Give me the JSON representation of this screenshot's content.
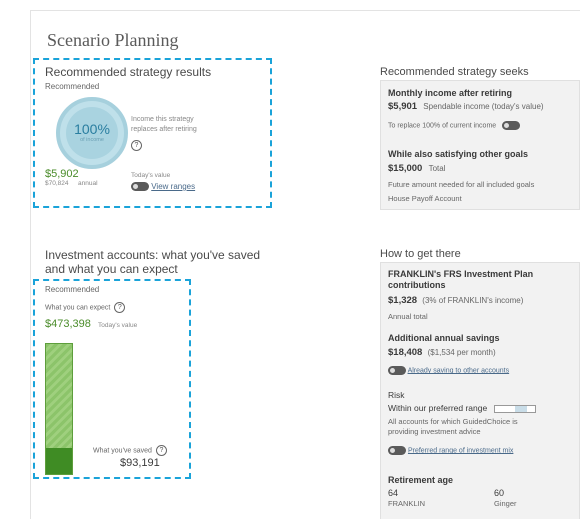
{
  "page": {
    "title": "Scenario Planning"
  },
  "strategy_results": {
    "heading": "Recommended strategy results",
    "badge": "Recommended",
    "percent": "100%",
    "percent_label": "of income",
    "replaces_text_1": "Income this strategy",
    "replaces_text_2": "replaces after retiring",
    "monthly": "$5,902",
    "annual_value": "$70,824",
    "annual_label": "annual",
    "todays_value": "Today's value",
    "view_ranges": "View ranges"
  },
  "seeks": {
    "heading": "Recommended strategy seeks",
    "monthly_title": "Monthly income after retiring",
    "monthly_value": "$5,901",
    "monthly_desc": "Spendable income (today's value)",
    "replace_text": "To replace 100% of current income",
    "other_title": "While also satisfying other goals",
    "other_value": "$15,000",
    "other_label": "Total",
    "future_text": "Future amount needed for all included goals",
    "goal_name": "House Payoff Account"
  },
  "investments": {
    "heading_1": "Investment accounts: what you've saved",
    "heading_2": "and what you can expect",
    "badge": "Recommended",
    "expect_label": "What you can expect",
    "expect_value": "$473,398",
    "expect_sub": "Today's value",
    "saved_label": "What you've saved",
    "saved_value": "$93,191",
    "saved_fraction": 0.197
  },
  "how": {
    "heading": "How to get there",
    "contrib_title_1": "FRANKLIN's FRS Investment Plan",
    "contrib_title_2": "contributions",
    "contrib_value": "$1,328",
    "contrib_desc": "(3% of FRANKLIN's income)",
    "annual_total": "Annual total",
    "savings_title": "Additional annual savings",
    "savings_value": "$18,408",
    "savings_desc": "($1,534 per month)",
    "already_saving": "Already saving to other accounts",
    "risk_title": "Risk",
    "risk_value": "Within our preferred range",
    "risk_desc_1": "All accounts for which GuidedChoice is",
    "risk_desc_2": "providing investment advice",
    "preferred_range": "Preferred range of investment mix",
    "retire_title": "Retirement age",
    "age_1": "64",
    "name_1": "FRANKLIN",
    "age_2": "60",
    "name_2": "Ginger"
  },
  "colors": {
    "accent_green": "#4a8c2a",
    "dash_blue": "#1aa3d9",
    "circle_blue": "#a9d3e0"
  }
}
